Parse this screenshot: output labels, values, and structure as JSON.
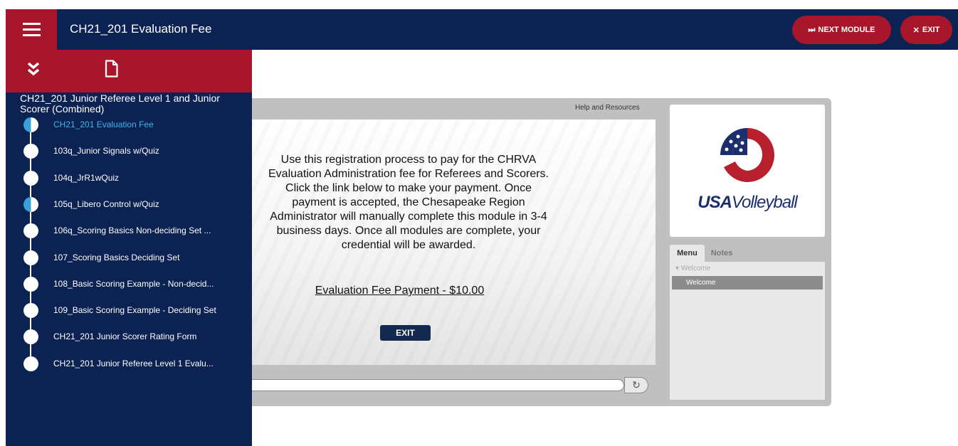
{
  "header": {
    "title": "CH21_201 Evaluation Fee",
    "next_module_label": "NEXT MODULE",
    "exit_label": "EXIT"
  },
  "sidebar": {
    "course_title": "CH21_201 Junior Referee Level 1 and Junior Scorer (Combined)",
    "modules": [
      {
        "label": "CH21_201 Evaluation Fee",
        "state": "active"
      },
      {
        "label": "103q_Junior Signals w/Quiz",
        "state": "not-started"
      },
      {
        "label": "104q_JrR1wQuiz",
        "state": "not-started"
      },
      {
        "label": "105q_Libero Control w/Quiz",
        "state": "in-progress"
      },
      {
        "label": "106q_Scoring Basics Non-deciding Set ...",
        "state": "not-started"
      },
      {
        "label": "107_Scoring Basics Deciding Set",
        "state": "not-started"
      },
      {
        "label": "108_Basic Scoring Example - Non-decid...",
        "state": "not-started"
      },
      {
        "label": "109_Basic Scoring Example - Deciding Set",
        "state": "not-started"
      },
      {
        "label": "CH21_201 Junior Scorer Rating Form",
        "state": "not-started"
      },
      {
        "label": "CH21_201 Junior Referee Level 1 Evalu...",
        "state": "not-started"
      }
    ]
  },
  "player": {
    "help_label": "Help and Resources",
    "body_lines": [
      "Use this registration process to pay for the CHRVA",
      "Evaluation Administration fee for Referees and Scorers.",
      "Click the link below to make your payment. Once",
      "payment is accepted, the Chesapeake Region",
      "Administrator will manually complete this module in 3-4",
      "business days. Once all modules are complete, your",
      "credential will be awarded."
    ],
    "payment_link": "Evaluation Fee Payment - $10.00",
    "exit_button": "EXIT",
    "logo": {
      "usa": "USA",
      "volleyball": "Volleyball"
    },
    "tabs": {
      "menu": "Menu",
      "notes": "Notes"
    },
    "menu_parent": "Welcome",
    "menu_child": "Welcome"
  },
  "colors": {
    "navy": "#0b2252",
    "red": "#a8162b",
    "active_blue": "#3fb3ea"
  }
}
